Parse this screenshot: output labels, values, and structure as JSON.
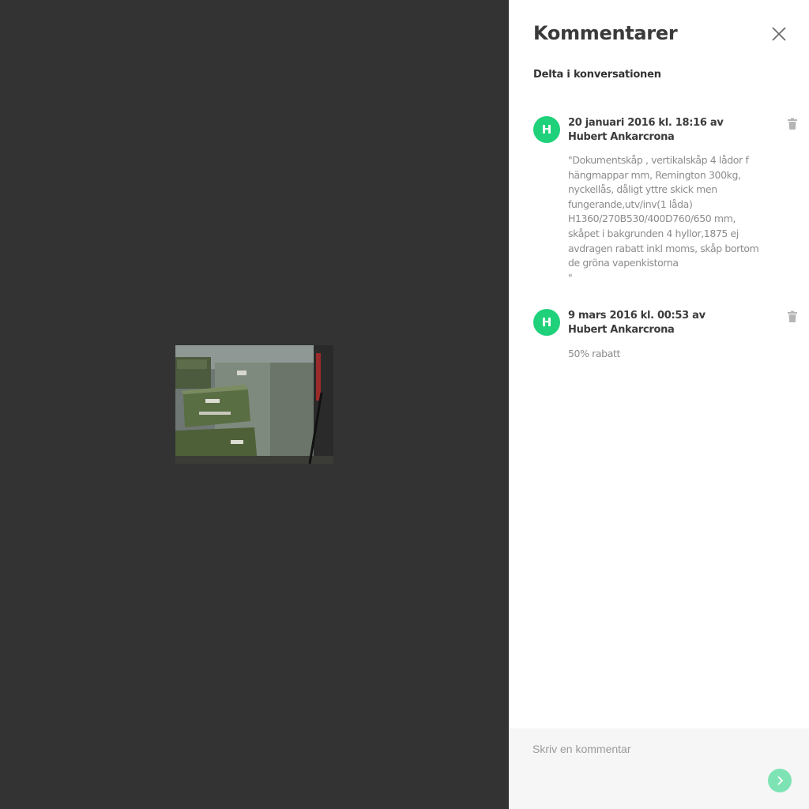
{
  "panel": {
    "title": "Kommentarer",
    "subtitle": "Delta i konversationen",
    "close_icon": "close-icon"
  },
  "comments": [
    {
      "avatar_letter": "H",
      "meta": "20 januari 2016 kl. 18:16 av Hubert Ankarcrona",
      "body": "\"Dokumentskåp , vertikalskåp 4 lådor f hängmappar mm, Remington 300kg, nyckellås, dåligt yttre skick men fungerande,utv/inv(1 låda) H1360/270B530/400D760/650 mm, skåpet i bakgrunden 4 hyllor,1875 ej avdragen rabatt inkl moms, skåp bortom de gröna vapenkistorna\n\"",
      "delete_icon": "trash-icon"
    },
    {
      "avatar_letter": "H",
      "meta": "9 mars 2016 kl. 00:53 av Hubert Ankarcrona",
      "body": "50% rabatt",
      "delete_icon": "trash-icon"
    }
  ],
  "composer": {
    "placeholder": "Skriv en kommentar",
    "value": "",
    "send_icon": "chevron-right-icon"
  },
  "colors": {
    "viewer_bg": "#333333",
    "accent": "#1ed17a",
    "send_button": "#7ee3b4"
  }
}
